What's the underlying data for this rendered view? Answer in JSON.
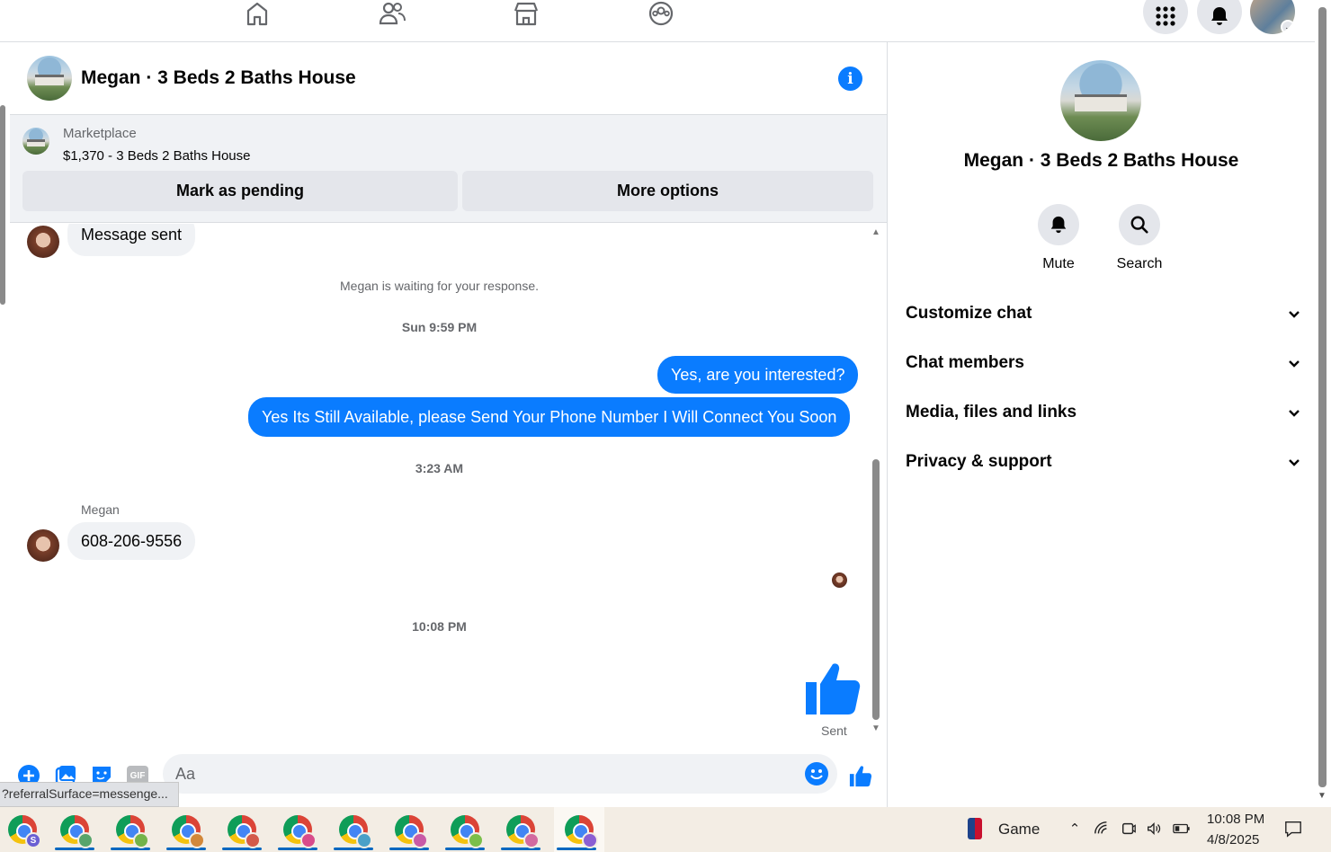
{
  "top_nav": {
    "icons": [
      "home-icon",
      "friends-icon",
      "marketplace-icon",
      "groups-icon"
    ],
    "right": [
      "menu-grid-icon",
      "notifications-bell-icon",
      "profile-avatar"
    ]
  },
  "chat": {
    "title": "Megan · 3 Beds 2 Baths House",
    "marketplace": {
      "label": "Marketplace",
      "listing": "$1,370 - 3 Beds 2 Baths House",
      "mark_pending": "Mark as pending",
      "more_options": "More options"
    },
    "messages": {
      "first_in": "Message sent",
      "waiting": "Megan is waiting for your response.",
      "ts1": "Sun 9:59 PM",
      "out1": "Yes, are you interested?",
      "out2": "Yes Its Still Available, please Send Your Phone Number I Will Connect You Soon",
      "ts2": "3:23 AM",
      "sender": "Megan",
      "in2": "608-206-9556",
      "ts3": "10:08 PM",
      "sent_label": "Sent"
    },
    "composer": {
      "placeholder": "Aa",
      "icons": [
        "add-icon",
        "photo-icon",
        "sticker-icon",
        "gif-icon",
        "emoji-icon",
        "like-icon"
      ],
      "gif_label": "GIF"
    },
    "status_url": "?referralSurface=messenge..."
  },
  "info_panel": {
    "title": "Megan · 3 Beds 2 Baths House",
    "actions": [
      {
        "label": "Mute",
        "icon": "bell-icon"
      },
      {
        "label": "Search",
        "icon": "search-icon"
      }
    ],
    "sections": [
      "Customize chat",
      "Chat members",
      "Media, files and links",
      "Privacy & support"
    ]
  },
  "taskbar": {
    "game_label": "Game",
    "time": "10:08 PM",
    "date": "4/8/2025",
    "first_badge": "S",
    "badge_colors": [
      "#6b5fd3",
      "#58a56b",
      "#73b34a",
      "#d2883a",
      "#d35a4a",
      "#d84c8b",
      "#4aa0c8",
      "#c85aa6",
      "#7bbf4a",
      "#d26aa0",
      "#8b5fd3"
    ]
  },
  "colors": {
    "accent": "#0a7cff",
    "panel_bg": "#f0f2f5"
  }
}
